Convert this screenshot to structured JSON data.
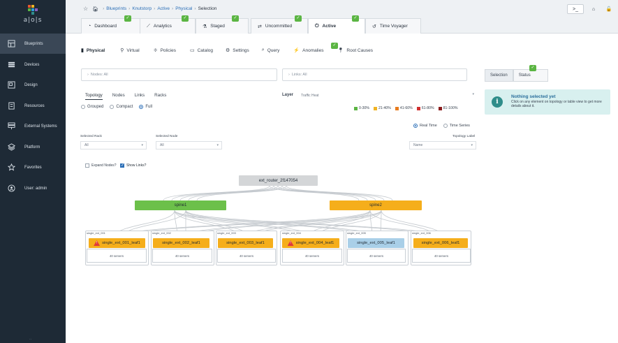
{
  "app": {
    "logo_text": "a|o|s",
    "bottom_mark": "··"
  },
  "sidebar": {
    "items": [
      {
        "label": "Blueprints",
        "icon": "blueprints-icon"
      },
      {
        "label": "Devices",
        "icon": "devices-icon"
      },
      {
        "label": "Design",
        "icon": "design-icon"
      },
      {
        "label": "Resources",
        "icon": "resources-icon"
      },
      {
        "label": "External Systems",
        "icon": "external-systems-icon"
      },
      {
        "label": "Platform",
        "icon": "platform-icon"
      },
      {
        "label": "Favorites",
        "icon": "star-icon"
      },
      {
        "label": "User: admin",
        "icon": "user-icon"
      }
    ]
  },
  "breadcrumb": {
    "items": [
      "Blueprints",
      "Knutstorp",
      "Active",
      "Physical"
    ],
    "current": "Selection"
  },
  "top_tabs": [
    {
      "label": "Dashboard",
      "icon": "dashboard-icon"
    },
    {
      "label": "Analytics",
      "icon": "analytics-icon"
    },
    {
      "label": "Staged",
      "icon": "staged-icon"
    },
    {
      "label": "Uncommitted",
      "icon": "uncommitted-icon"
    },
    {
      "label": "Active",
      "icon": "power-icon"
    },
    {
      "label": "Time Voyager",
      "icon": "time-voyager-icon"
    }
  ],
  "top_right": {
    "terminal": ">_",
    "home": "⌂",
    "lock": "🔓"
  },
  "sub_tabs": [
    {
      "label": "Physical",
      "icon": "physical-icon"
    },
    {
      "label": "Virtual",
      "icon": "virtual-icon"
    },
    {
      "label": "Policies",
      "icon": "policies-icon"
    },
    {
      "label": "Catalog",
      "icon": "catalog-icon"
    },
    {
      "label": "Settings",
      "icon": "settings-icon"
    },
    {
      "label": "Query",
      "icon": "query-icon"
    },
    {
      "label": "Anomalies",
      "icon": "anomalies-icon"
    },
    {
      "label": "Root Causes",
      "icon": "root-causes-icon"
    }
  ],
  "filters": {
    "nodes": "Nodes: All",
    "links": "Links: All"
  },
  "panel": {
    "tabs": [
      "Selection",
      "Status"
    ],
    "info_title": "Nothing selected yet",
    "info_text": "Click on any element on topology or table view to get more details about it."
  },
  "topology_tabs": [
    "Topology",
    "Nodes",
    "Links",
    "Racks"
  ],
  "view_mode": [
    "Grouped",
    "Compact",
    "Full"
  ],
  "layer": {
    "label": "Layer",
    "value": "Traffic Heat"
  },
  "heat_legend": [
    {
      "label": "0-30%",
      "color": "#5bb543"
    },
    {
      "label": "21-40%",
      "color": "#f0b323"
    },
    {
      "label": "41-60%",
      "color": "#e87c1e"
    },
    {
      "label": "61-80%",
      "color": "#d12f2f"
    },
    {
      "label": "81-100%",
      "color": "#8b1c1c"
    }
  ],
  "time_mode": [
    "Real Time",
    "Time Series"
  ],
  "selected_rack": {
    "label": "Selected Rack",
    "value": "All"
  },
  "selected_node": {
    "label": "Selected Node",
    "value": "All"
  },
  "topology_label": {
    "label": "Topology Label",
    "value": "Name"
  },
  "options": {
    "expand_nodes": "Expand Nodes?",
    "show_links": "Show Links?"
  },
  "topology": {
    "router": "ext_router_2f147054",
    "spines": [
      {
        "label": "spine1",
        "color": "#6cc04a"
      },
      {
        "label": "spine2",
        "color": "#f5ae1b"
      }
    ],
    "racks": [
      {
        "rack": "single_ext_001",
        "leaf": "single_ext_001_leaf1",
        "warn": true,
        "color": "#f5ae1b",
        "servers": "40 servers"
      },
      {
        "rack": "single_ext_002",
        "leaf": "single_ext_002_leaf1",
        "warn": false,
        "color": "#f5ae1b",
        "servers": "40 servers"
      },
      {
        "rack": "single_ext_003",
        "leaf": "single_ext_003_leaf1",
        "warn": false,
        "color": "#f5ae1b",
        "servers": "40 servers"
      },
      {
        "rack": "single_ext_004",
        "leaf": "single_ext_004_leaf1",
        "warn": true,
        "color": "#f5ae1b",
        "servers": "40 servers"
      },
      {
        "rack": "single_ext_005",
        "leaf": "single_ext_005_leaf1",
        "warn": false,
        "color": "#a9cfe8",
        "servers": "40 servers"
      },
      {
        "rack": "single_ext_006",
        "leaf": "single_ext_006_leaf1",
        "warn": false,
        "color": "#f5ae1b",
        "servers": "40 servers"
      }
    ]
  }
}
